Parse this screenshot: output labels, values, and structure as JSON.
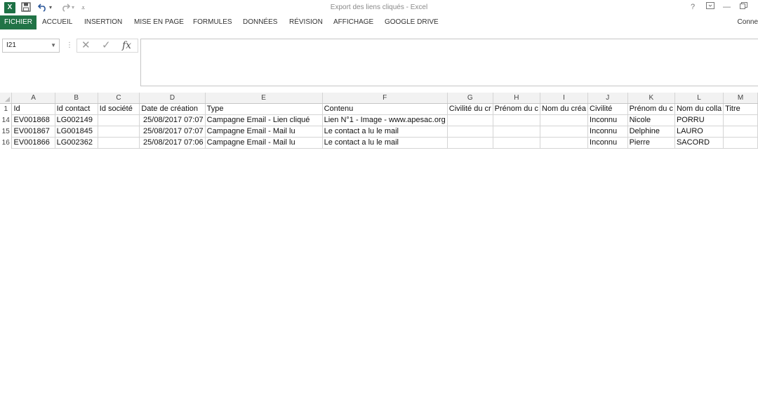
{
  "window": {
    "title": "Export des liens cliqués - Excel",
    "app_icon": "excel-icon",
    "controls": [
      "help-icon",
      "ribbon-display-icon",
      "minimize-icon",
      "restore-icon"
    ]
  },
  "quick_access": {
    "save_icon": "save-icon",
    "undo_icon": "undo-icon",
    "redo_icon": "redo-icon",
    "customize_icon": "customize-qat-icon"
  },
  "ribbon": {
    "tabs": [
      "FICHIER",
      "ACCUEIL",
      "INSERTION",
      "MISE EN PAGE",
      "FORMULES",
      "DONNÉES",
      "RÉVISION",
      "AFFICHAGE",
      "GOOGLE DRIVE"
    ],
    "active_tab": "FICHIER",
    "account_label": "Conne",
    "accent_color": "#217346"
  },
  "formula_bar": {
    "name_box": "I21",
    "formula_value": ""
  },
  "sheet": {
    "columns": [
      "A",
      "B",
      "C",
      "D",
      "E",
      "F",
      "G",
      "H",
      "I",
      "J",
      "K",
      "L",
      "M"
    ],
    "header_row": {
      "row_number": "1",
      "cells": [
        "Id",
        "Id contact",
        "Id société",
        "Date de création",
        "Type",
        "Contenu",
        "Civilité du cr",
        "Prénom du c",
        "Nom du créa",
        "Civilité",
        "Prénom du c",
        "Nom du colla",
        "Titre"
      ]
    },
    "rows": [
      {
        "row_number": "14",
        "cells": [
          "EV001868",
          "LG002149",
          "",
          "25/08/2017 07:07",
          "Campagne Email - Lien cliqué",
          "Lien N°1 - Image - www.apesac.org",
          "",
          "",
          "",
          "Inconnu",
          "Nicole",
          "PORRU",
          ""
        ]
      },
      {
        "row_number": "15",
        "cells": [
          "EV001867",
          "LG001845",
          "",
          "25/08/2017 07:07",
          "Campagne Email - Mail lu",
          "Le contact a lu le mail",
          "",
          "",
          "",
          "Inconnu",
          "Delphine",
          "LAURO",
          ""
        ]
      },
      {
        "row_number": "16",
        "cells": [
          "EV001866",
          "LG002362",
          "",
          "25/08/2017 07:06",
          "Campagne Email - Mail lu",
          "Le contact a lu le mail",
          "",
          "",
          "",
          "Inconnu",
          "Pierre",
          "SACORD",
          ""
        ]
      }
    ]
  }
}
